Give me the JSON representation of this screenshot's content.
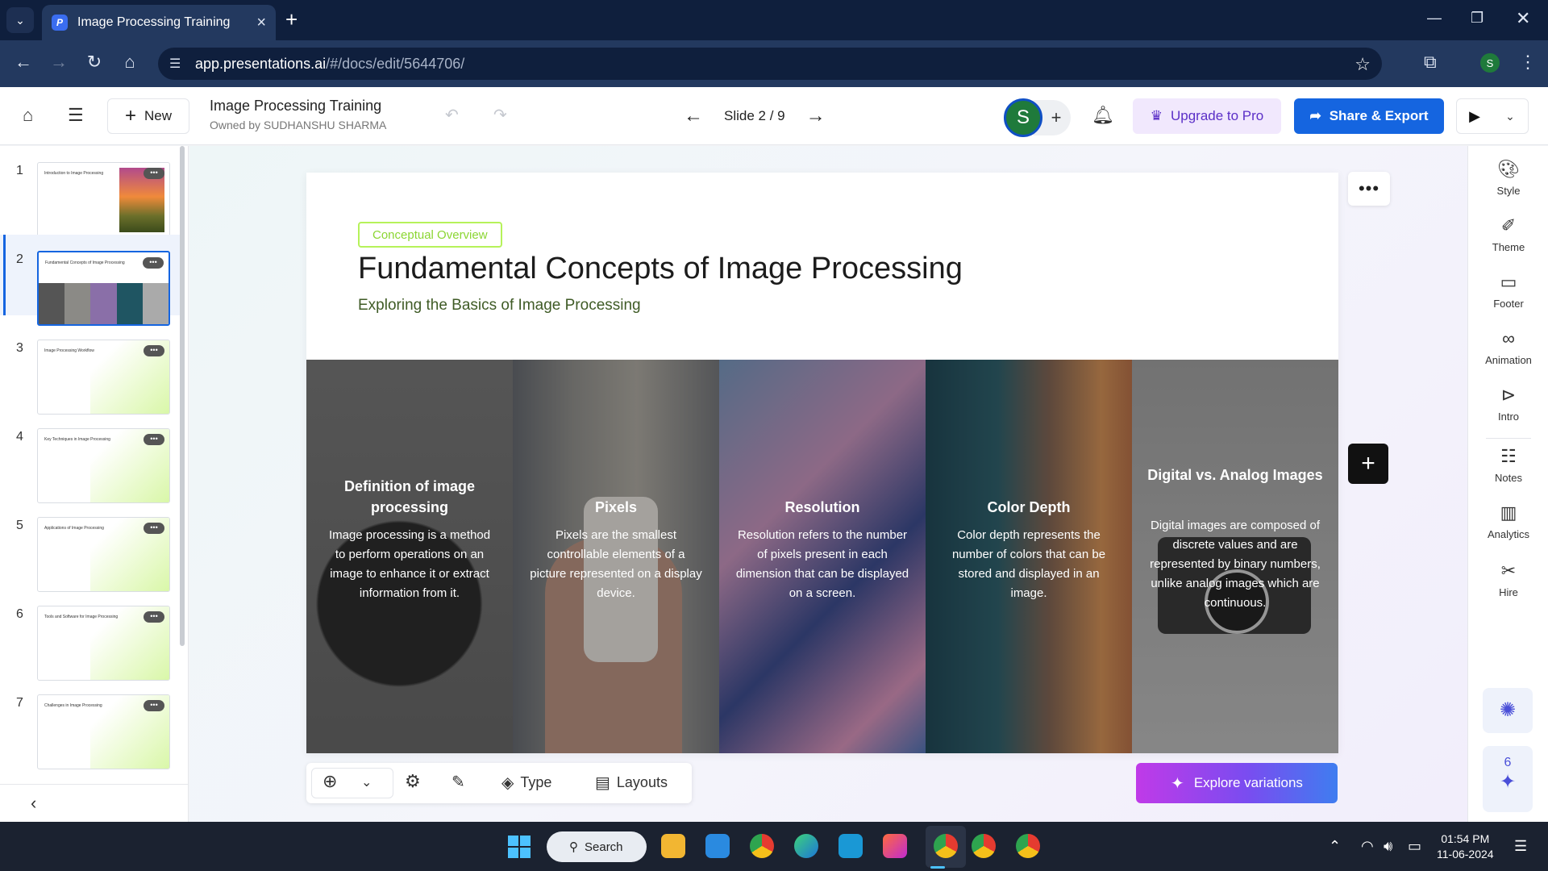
{
  "browser": {
    "tab_title": "Image Processing Training",
    "tab_favicon": "P",
    "url_domain": "app.presentations.ai",
    "url_path": "/#/docs/edit/5644706/",
    "profile_initial": "S"
  },
  "header": {
    "new_label": "New",
    "doc_title": "Image Processing Training",
    "owner": "Owned by SUDHANSHU SHARMA",
    "slide_counter": "Slide 2 / 9",
    "avatar_initial": "S",
    "upgrade_label": "Upgrade to Pro",
    "share_label": "Share & Export"
  },
  "thumbnails": [
    {
      "num": "1",
      "title": "Introduction to Image Processing"
    },
    {
      "num": "2",
      "title": "Fundamental Concepts of Image Processing"
    },
    {
      "num": "3",
      "title": "Image Processing Workflow"
    },
    {
      "num": "4",
      "title": "Key Techniques in Image Processing"
    },
    {
      "num": "5",
      "title": "Applications of Image Processing"
    },
    {
      "num": "6",
      "title": "Tools and Software for Image Processing"
    },
    {
      "num": "7",
      "title": "Challenges in Image Processing"
    }
  ],
  "slide": {
    "chip": "Conceptual Overview",
    "title": "Fundamental Concepts of Image Processing",
    "subtitle": "Exploring the Basics of Image Processing",
    "panels": [
      {
        "title": "Definition of image processing",
        "body": "Image processing is a method to perform operations on an image to enhance it or extract information from it."
      },
      {
        "title": "Pixels",
        "body": "Pixels are the smallest controllable elements of a picture represented on a display device."
      },
      {
        "title": "Resolution",
        "body": "Resolution refers to the number of pixels present in each dimension that can be displayed on a screen."
      },
      {
        "title": "Color Depth",
        "body": "Color depth represents the number of colors that can be stored and displayed in an image."
      },
      {
        "title": "Digital vs. Analog Images",
        "body": "Digital images are composed of discrete values and are represented by binary numbers, unlike analog images which are continuous."
      }
    ]
  },
  "toolbar": {
    "type_label": "Type",
    "layouts_label": "Layouts",
    "explore_label": "Explore variations"
  },
  "right_rail": {
    "items": [
      "Style",
      "Theme",
      "Footer",
      "Animation",
      "Intro",
      "Notes",
      "Analytics",
      "Hire"
    ],
    "count": "6"
  },
  "taskbar": {
    "search_label": "Search",
    "time": "01:54 PM",
    "date": "11-06-2024"
  },
  "colors": {
    "accent": "#1565e0",
    "chip_green": "#b6f25a",
    "upgrade_purple": "#5b2fc7",
    "browser_dark": "#0f1f3d"
  }
}
